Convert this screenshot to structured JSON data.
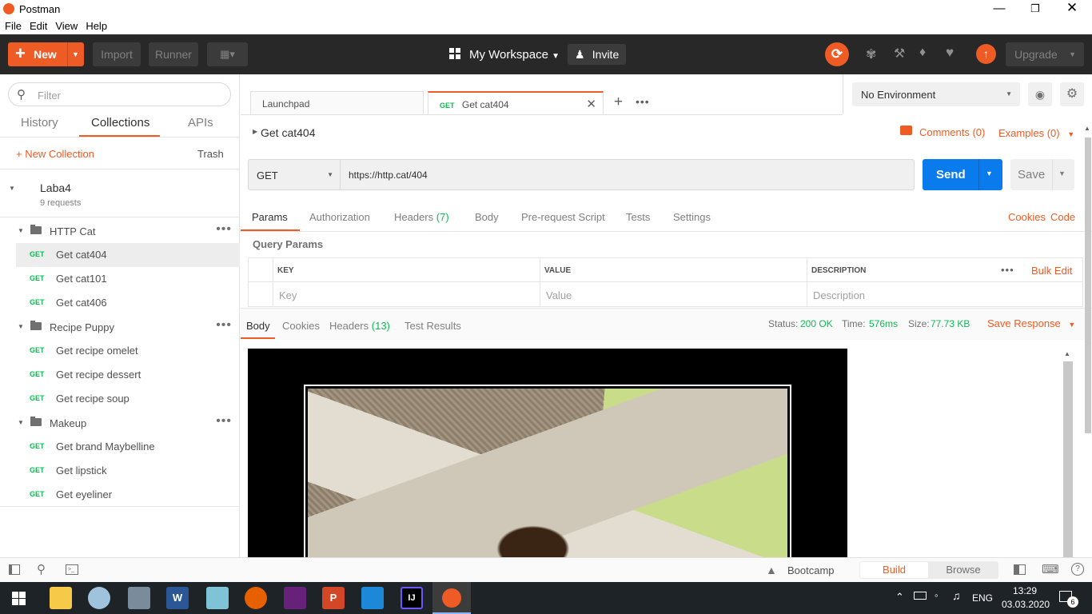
{
  "app": {
    "title": "Postman",
    "menu": [
      "File",
      "Edit",
      "View",
      "Help"
    ]
  },
  "header": {
    "new_label": "New",
    "import_label": "Import",
    "runner_label": "Runner",
    "workspace_label": "My Workspace",
    "invite_label": "Invite",
    "upgrade_label": "Upgrade"
  },
  "sidebar": {
    "filter_placeholder": "Filter",
    "tabs": [
      "History",
      "Collections",
      "APIs"
    ],
    "new_collection": "+ New Collection",
    "trash": "Trash",
    "collection": {
      "name": "Laba4",
      "count": "9 requests"
    },
    "folders": [
      {
        "name": "HTTP Cat",
        "requests": [
          {
            "method": "GET",
            "name": "Get cat404"
          },
          {
            "method": "GET",
            "name": "Get cat101"
          },
          {
            "method": "GET",
            "name": "Get cat406"
          }
        ]
      },
      {
        "name": "Recipe Puppy",
        "requests": [
          {
            "method": "GET",
            "name": "Get recipe omelet"
          },
          {
            "method": "GET",
            "name": "Get recipe dessert"
          },
          {
            "method": "GET",
            "name": "Get recipe soup"
          }
        ]
      },
      {
        "name": "Makeup",
        "requests": [
          {
            "method": "GET",
            "name": "Get brand Maybelline"
          },
          {
            "method": "GET",
            "name": "Get lipstick"
          },
          {
            "method": "GET",
            "name": "Get eyeliner"
          }
        ]
      }
    ]
  },
  "tabs": [
    {
      "label": "Launchpad"
    },
    {
      "method": "GET",
      "label": "Get cat404"
    }
  ],
  "environment": {
    "selected": "No Environment"
  },
  "request": {
    "name": "Get cat404",
    "comments": "Comments (0)",
    "examples": "Examples (0)",
    "method": "GET",
    "url": "https://http.cat/404",
    "send": "Send",
    "save": "Save",
    "subtabs": [
      "Params",
      "Authorization",
      "Headers",
      "(7)",
      "Body",
      "Pre-request Script",
      "Tests",
      "Settings"
    ],
    "cookies": "Cookies",
    "code": "Code",
    "query_params_title": "Query Params",
    "columns": [
      "KEY",
      "VALUE",
      "DESCRIPTION"
    ],
    "bulk_edit": "Bulk Edit",
    "placeholders": [
      "Key",
      "Value",
      "Description"
    ]
  },
  "response": {
    "tabs": [
      "Body",
      "Cookies",
      "Headers",
      "(13)",
      "Test Results"
    ],
    "status_label": "Status:",
    "status": "200 OK",
    "time_label": "Time:",
    "time": "576ms",
    "size_label": "Size:",
    "size": "77.73 KB",
    "save_response": "Save Response"
  },
  "statusbar": {
    "bootcamp": "Bootcamp",
    "build": "Build",
    "browse": "Browse"
  },
  "taskbar": {
    "lang": "ENG",
    "time": "13:29",
    "date": "03.03.2020",
    "notifications": "6"
  },
  "colors": {
    "accent": "#ef5b25",
    "send": "#097bed",
    "get": "#0cbb52"
  }
}
